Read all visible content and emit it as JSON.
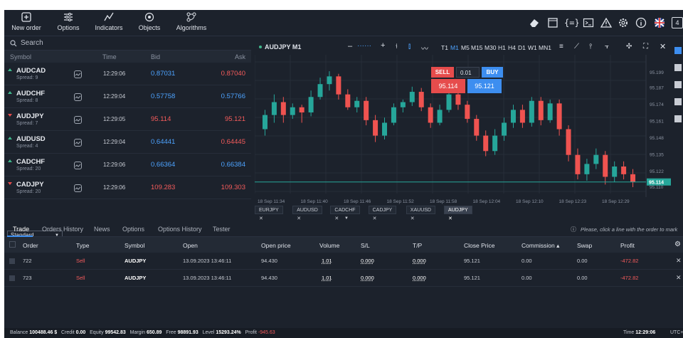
{
  "toolbar": {
    "items": [
      {
        "label": "New order",
        "icon": "new-order-icon"
      },
      {
        "label": "Options",
        "icon": "sliders-icon"
      },
      {
        "label": "Indicators",
        "icon": "indicators-icon"
      },
      {
        "label": "Objects",
        "icon": "objects-icon"
      },
      {
        "label": "Algorithms",
        "icon": "algorithms-icon"
      }
    ],
    "right_icons": [
      "eraser-icon",
      "window-icon",
      "code-braces-icon",
      "terminal-icon",
      "warning-icon",
      "gear-icon",
      "info-icon",
      "uk-flag-icon"
    ],
    "right_counter": "4"
  },
  "market": {
    "search_placeholder": "Search",
    "columns": {
      "symbol": "Symbol",
      "time": "Time",
      "bid": "Bid",
      "ask": "Ask"
    },
    "rows": [
      {
        "symbol": "AUDCAD",
        "spread": "Spread: 9",
        "dir": "up",
        "time": "12:29:06",
        "bid": "0.87031",
        "ask": "0.87040",
        "bid_color": "blue",
        "ask_color": "red"
      },
      {
        "symbol": "AUDCHF",
        "spread": "Spread: 8",
        "dir": "up",
        "time": "12:29:04",
        "bid": "0.57758",
        "ask": "0.57766",
        "bid_color": "blue",
        "ask_color": "blue"
      },
      {
        "symbol": "AUDJPY",
        "spread": "Spread: 7",
        "dir": "down",
        "time": "12:29:05",
        "bid": "95.114",
        "ask": "95.121",
        "bid_color": "red",
        "ask_color": "red"
      },
      {
        "symbol": "AUDUSD",
        "spread": "Spread: 4",
        "dir": "up",
        "time": "12:29:04",
        "bid": "0.64441",
        "ask": "0.64445",
        "bid_color": "blue",
        "ask_color": "red"
      },
      {
        "symbol": "CADCHF",
        "spread": "Spread: 20",
        "dir": "up",
        "time": "12:29:06",
        "bid": "0.66364",
        "ask": "0.66384",
        "bid_color": "blue",
        "ask_color": "blue"
      },
      {
        "symbol": "CADJPY",
        "spread": "Spread: 20",
        "dir": "down",
        "time": "12:29:06",
        "bid": "109.283",
        "ask": "109.303",
        "bid_color": "red",
        "ask_color": "red"
      }
    ],
    "group_select": "Standard"
  },
  "chart": {
    "title": "AUDJPY M1",
    "timeframes": [
      "T1",
      "M1",
      "M5",
      "M15",
      "M30",
      "H1",
      "H4",
      "D1",
      "W1",
      "MN1"
    ],
    "active_timeframe": "M1",
    "sell_label": "SELL",
    "buy_label": "BUY",
    "volume": "0.01",
    "sell_price": "95.114",
    "buy_price": "95.121",
    "tabs": [
      "EURJPY",
      "AUDUSD",
      "CADCHF",
      "CADJPY",
      "XAUUSD",
      "AUDJPY"
    ],
    "active_tab": "AUDJPY"
  },
  "chart_data": {
    "type": "candlestick",
    "y_ticks": [
      "95.199",
      "95.187",
      "95.174",
      "95.161",
      "95.148",
      "95.135",
      "95.122",
      "95.110"
    ],
    "x_ticks": [
      "18 Sep 11:34",
      "18 Sep 11:40",
      "18 Sep 11:46",
      "18 Sep 11:52",
      "18 Sep 11:58",
      "18 Sep 12:04",
      "18 Sep 12:10",
      "18 Sep 12:23",
      "18 Sep 12:29"
    ],
    "current_price": "95.114",
    "ylim": [
      95.105,
      95.21
    ],
    "candles": [
      {
        "o": 95.155,
        "c": 95.166,
        "h": 95.17,
        "l": 95.15
      },
      {
        "o": 95.166,
        "c": 95.176,
        "h": 95.182,
        "l": 95.16
      },
      {
        "o": 95.176,
        "c": 95.166,
        "h": 95.18,
        "l": 95.16
      },
      {
        "o": 95.166,
        "c": 95.172,
        "h": 95.175,
        "l": 95.163
      },
      {
        "o": 95.172,
        "c": 95.168,
        "h": 95.174,
        "l": 95.16
      },
      {
        "o": 95.168,
        "c": 95.18,
        "h": 95.185,
        "l": 95.165
      },
      {
        "o": 95.18,
        "c": 95.19,
        "h": 95.195,
        "l": 95.178
      },
      {
        "o": 95.19,
        "c": 95.196,
        "h": 95.2,
        "l": 95.185
      },
      {
        "o": 95.196,
        "c": 95.182,
        "h": 95.198,
        "l": 95.178
      },
      {
        "o": 95.182,
        "c": 95.172,
        "h": 95.186,
        "l": 95.17
      },
      {
        "o": 95.172,
        "c": 95.177,
        "h": 95.18,
        "l": 95.168
      },
      {
        "o": 95.177,
        "c": 95.162,
        "h": 95.18,
        "l": 95.158
      },
      {
        "o": 95.162,
        "c": 95.15,
        "h": 95.166,
        "l": 95.145
      },
      {
        "o": 95.15,
        "c": 95.16,
        "h": 95.164,
        "l": 95.147
      },
      {
        "o": 95.16,
        "c": 95.172,
        "h": 95.175,
        "l": 95.158
      },
      {
        "o": 95.172,
        "c": 95.176,
        "h": 95.178,
        "l": 95.168
      },
      {
        "o": 95.176,
        "c": 95.184,
        "h": 95.188,
        "l": 95.173
      },
      {
        "o": 95.184,
        "c": 95.172,
        "h": 95.187,
        "l": 95.169
      },
      {
        "o": 95.172,
        "c": 95.16,
        "h": 95.175,
        "l": 95.156
      },
      {
        "o": 95.16,
        "c": 95.17,
        "h": 95.174,
        "l": 95.158
      },
      {
        "o": 95.17,
        "c": 95.182,
        "h": 95.186,
        "l": 95.168
      },
      {
        "o": 95.182,
        "c": 95.174,
        "h": 95.185,
        "l": 95.17
      },
      {
        "o": 95.174,
        "c": 95.163,
        "h": 95.177,
        "l": 95.16
      },
      {
        "o": 95.163,
        "c": 95.15,
        "h": 95.166,
        "l": 95.146
      },
      {
        "o": 95.15,
        "c": 95.138,
        "h": 95.154,
        "l": 95.134
      },
      {
        "o": 95.138,
        "c": 95.15,
        "h": 95.155,
        "l": 95.135
      },
      {
        "o": 95.15,
        "c": 95.16,
        "h": 95.164,
        "l": 95.146
      },
      {
        "o": 95.16,
        "c": 95.17,
        "h": 95.174,
        "l": 95.156
      },
      {
        "o": 95.17,
        "c": 95.16,
        "h": 95.174,
        "l": 95.156
      },
      {
        "o": 95.16,
        "c": 95.177,
        "h": 95.18,
        "l": 95.157
      },
      {
        "o": 95.177,
        "c": 95.162,
        "h": 95.18,
        "l": 95.158
      },
      {
        "o": 95.162,
        "c": 95.175,
        "h": 95.178,
        "l": 95.16
      },
      {
        "o": 95.175,
        "c": 95.155,
        "h": 95.178,
        "l": 95.15
      },
      {
        "o": 95.155,
        "c": 95.135,
        "h": 95.158,
        "l": 95.13
      },
      {
        "o": 95.135,
        "c": 95.12,
        "h": 95.14,
        "l": 95.116
      },
      {
        "o": 95.12,
        "c": 95.128,
        "h": 95.132,
        "l": 95.115
      },
      {
        "o": 95.128,
        "c": 95.135,
        "h": 95.14,
        "l": 95.124
      },
      {
        "o": 95.135,
        "c": 95.118,
        "h": 95.138,
        "l": 95.112
      },
      {
        "o": 95.118,
        "c": 95.126,
        "h": 95.13,
        "l": 95.114
      },
      {
        "o": 95.126,
        "c": 95.12,
        "h": 95.13,
        "l": 95.116
      },
      {
        "o": 95.12,
        "c": 95.114,
        "h": 95.124,
        "l": 95.11
      }
    ]
  },
  "bottom": {
    "tabs": [
      "Trade",
      "Orders History",
      "News",
      "Options",
      "Options History",
      "Tester"
    ],
    "active_tab": "Trade",
    "hint": "Please, click a line with the order to mark",
    "columns": [
      "Order",
      "Type",
      "Symbol",
      "Open",
      "Open price",
      "Volume",
      "S/L",
      "T/P",
      "Close Price",
      "Commission ▴",
      "Swap",
      "Profit"
    ],
    "orders": [
      {
        "order": "722",
        "type": "Sell",
        "symbol": "AUDJPY",
        "open": "13.09.2023 13:46:11",
        "open_price": "94.430",
        "volume": "1.01",
        "sl": "0.000",
        "tp": "0.000",
        "close_price": "95.121",
        "commission": "0.00",
        "swap": "0.00",
        "profit": "-472.82"
      },
      {
        "order": "723",
        "type": "Sell",
        "symbol": "AUDJPY",
        "open": "13.09.2023 13:46:11",
        "open_price": "94.430",
        "volume": "1.01",
        "sl": "0.000",
        "tp": "0.000",
        "close_price": "95.121",
        "commission": "0.00",
        "swap": "0.00",
        "profit": "-472.82"
      }
    ]
  },
  "status": {
    "balance_label": "Balance",
    "balance": "100488.46 $",
    "credit_label": "Credit",
    "credit": "0.00",
    "equity_label": "Equity",
    "equity": "99542.83",
    "margin_label": "Margin",
    "margin": "650.89",
    "free_label": "Free",
    "free": "98891.93",
    "level_label": "Level",
    "level": "15293.24%",
    "profit_label": "Profit",
    "profit": "-945.63",
    "time_label": "Time",
    "time": "12:29:06",
    "tz": "UTC+"
  },
  "colors": {
    "bg": "#1c222c",
    "up": "#26a69a",
    "down": "#ef5350",
    "sell": "#e64c4c",
    "buy": "#3d8ef0",
    "bid_blue": "#4da3ff",
    "bid_red": "#f45b5b"
  }
}
